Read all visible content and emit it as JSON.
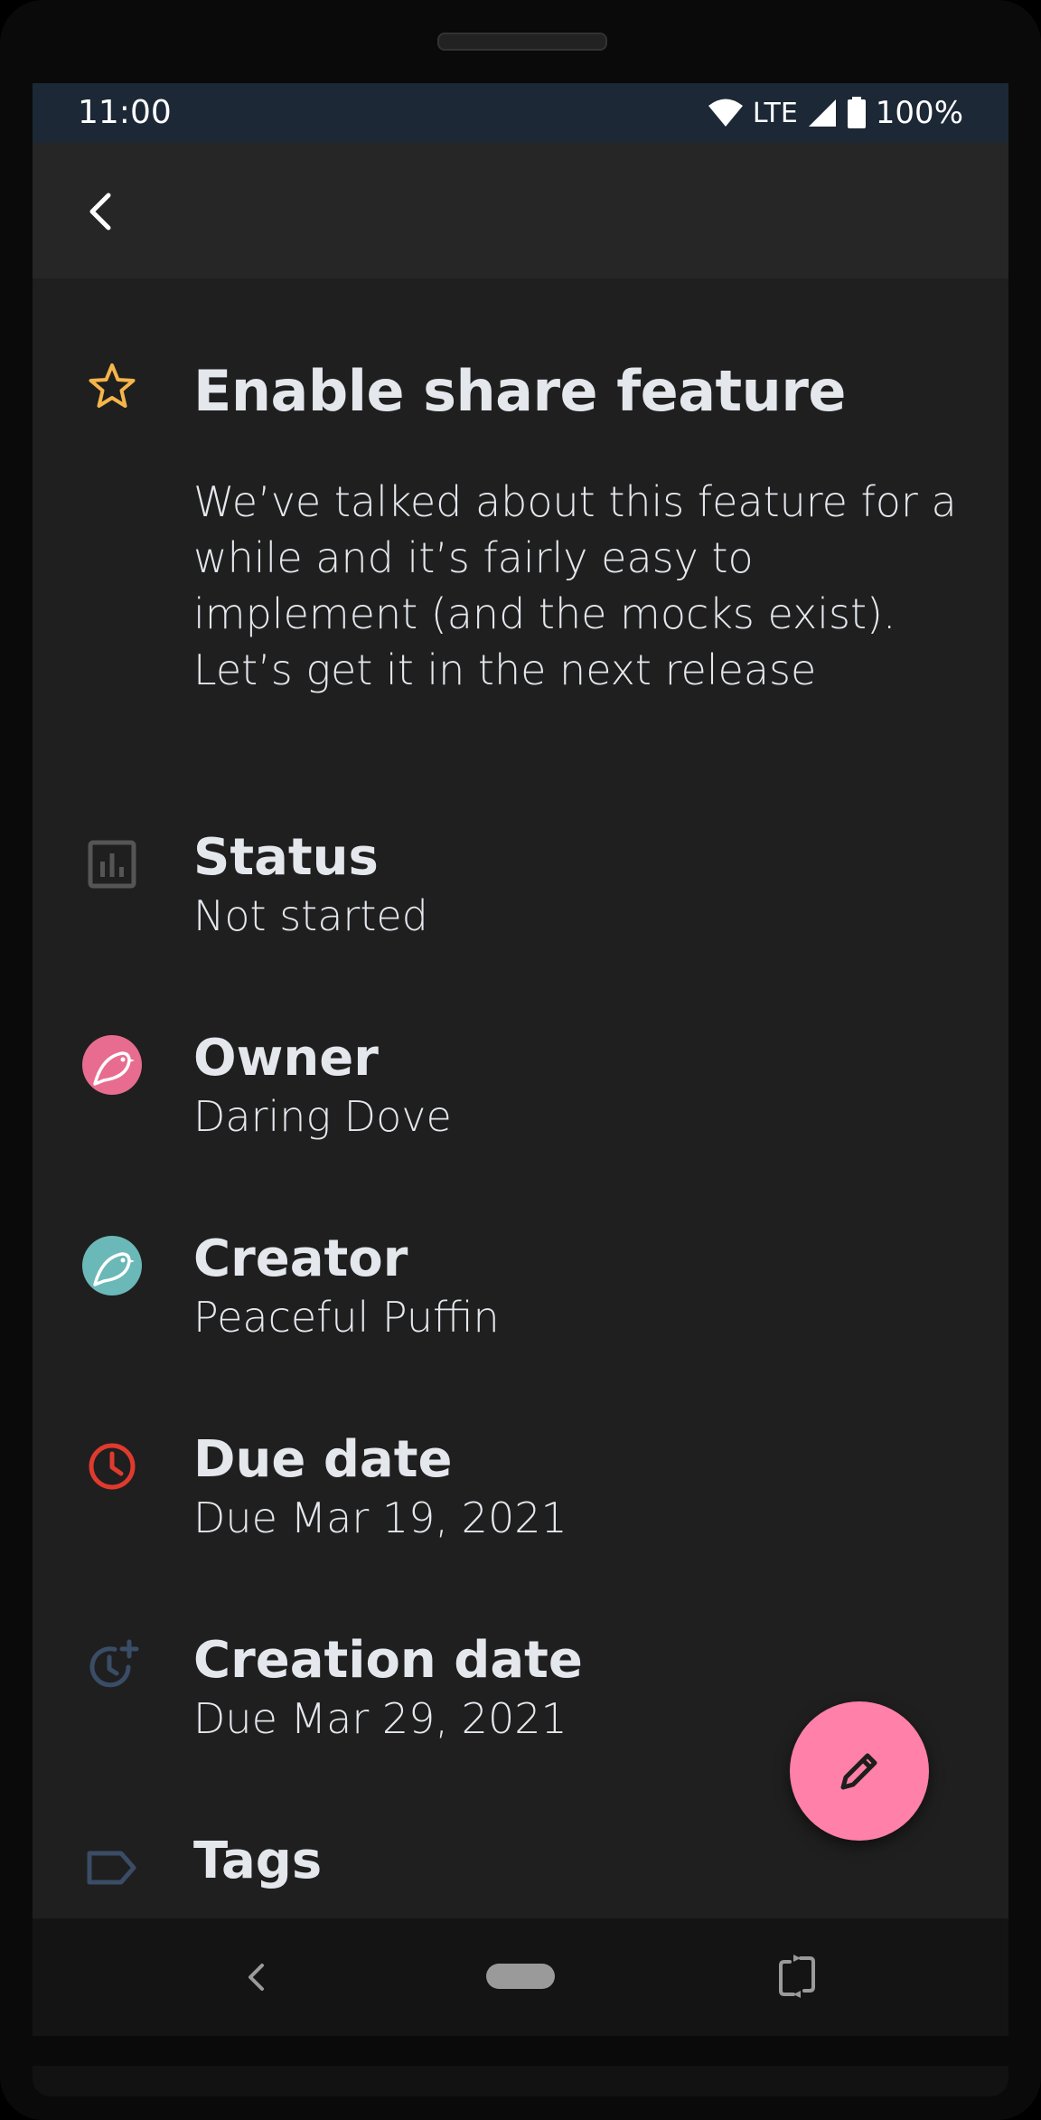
{
  "status_bar": {
    "time": "11:00",
    "network": "LTE",
    "battery": "100%"
  },
  "task": {
    "title": "Enable share feature",
    "description": "We’ve talked about this feature for a while and it’s fairly easy to implement (and the mocks exist). Let’s get it in the next release"
  },
  "fields": {
    "status": {
      "label": "Status",
      "value": "Not started"
    },
    "owner": {
      "label": "Owner",
      "value": "Daring Dove"
    },
    "creator": {
      "label": "Creator",
      "value": "Peaceful Puffin"
    },
    "due_date": {
      "label": "Due date",
      "value": "Due Mar 19, 2021"
    },
    "creation_date": {
      "label": "Creation date",
      "value": "Due Mar 29, 2021"
    },
    "tags": {
      "label": "Tags"
    }
  },
  "icons": {
    "back": "chevron-left-icon",
    "star": "star-outline-icon",
    "status": "chart-icon",
    "owner": "bird-avatar-icon",
    "creator": "bird-avatar-icon",
    "due_date": "clock-icon",
    "creation_date": "clock-plus-icon",
    "tags": "label-icon",
    "fab": "pencil-icon"
  },
  "colors": {
    "star": "#f5b54a",
    "owner_avatar": "#e86c8f",
    "creator_avatar": "#6bb8b8",
    "due_clock": "#e03a2e",
    "muted_icon": "#3a4c66",
    "fab": "#ff80a8"
  }
}
